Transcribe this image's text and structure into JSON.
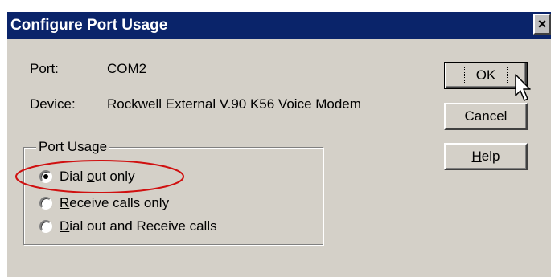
{
  "window": {
    "title": "Configure Port Usage",
    "close_label": "×"
  },
  "info": {
    "port_label": "Port:",
    "port_value": "COM2",
    "device_label": "Device:",
    "device_value": "Rockwell External V.90 K56 Voice Modem"
  },
  "port_usage": {
    "legend": "Port Usage",
    "options": [
      {
        "pre": "Dial ",
        "mnemonic": "o",
        "post": "ut only",
        "checked": true
      },
      {
        "pre": "",
        "mnemonic": "R",
        "post": "eceive calls only",
        "checked": false
      },
      {
        "pre": "",
        "mnemonic": "D",
        "post": "ial out and Receive calls",
        "checked": false
      }
    ]
  },
  "buttons": {
    "ok": "OK",
    "cancel": "Cancel",
    "help_mnemonic": "H",
    "help_rest": "elp"
  },
  "colors": {
    "titlebar": "#0a246a",
    "dialog_face": "#d4d0c8",
    "annotation_ellipse": "#d01010"
  },
  "icons": {
    "close": "close-icon",
    "cursor": "mouse-pointer-icon"
  }
}
